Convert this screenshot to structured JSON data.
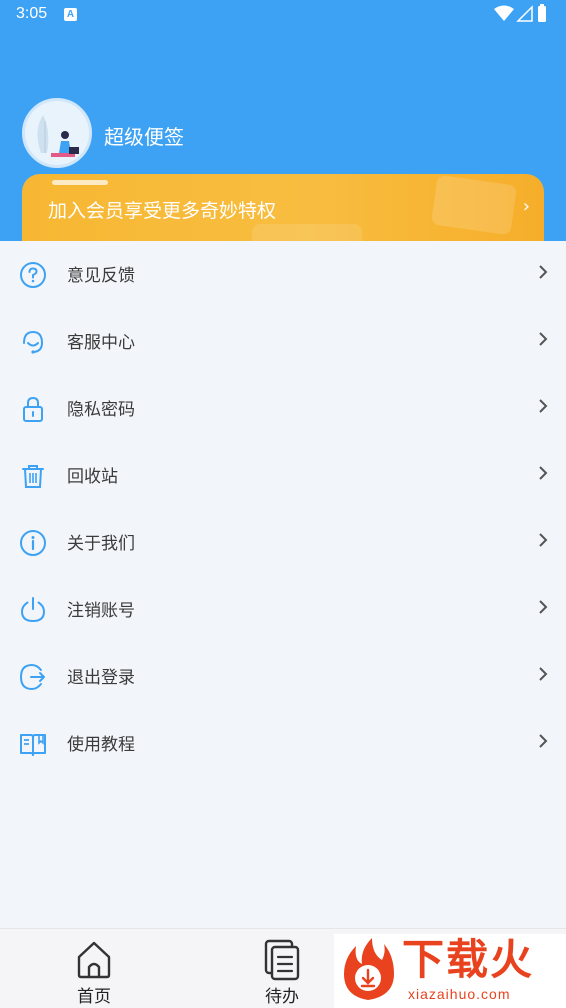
{
  "status_bar": {
    "time": "3:05",
    "notification_letter": "A"
  },
  "profile": {
    "username": "超级便签"
  },
  "vip_banner": {
    "text": "加入会员享受更多奇妙特权",
    "arrow": "›"
  },
  "menu": {
    "items": [
      {
        "label": "意见反馈",
        "icon": "help-circle-icon"
      },
      {
        "label": "客服中心",
        "icon": "headset-icon"
      },
      {
        "label": "隐私密码",
        "icon": "lock-icon"
      },
      {
        "label": "回收站",
        "icon": "trash-icon"
      },
      {
        "label": "关于我们",
        "icon": "info-icon"
      },
      {
        "label": "注销账号",
        "icon": "power-icon"
      },
      {
        "label": "退出登录",
        "icon": "logout-icon"
      },
      {
        "label": "使用教程",
        "icon": "book-icon"
      }
    ]
  },
  "tabbar": {
    "tabs": [
      {
        "label": "首页",
        "icon": "home-icon"
      },
      {
        "label": "待办",
        "icon": "todo-icon"
      }
    ]
  },
  "watermark": {
    "brand": "下载火",
    "domain": "xiazaihuo.com"
  },
  "colors": {
    "header": "#3ea2f4",
    "vip": "#f7b733",
    "icon": "#3ea2f4",
    "brand": "#e8431e"
  }
}
